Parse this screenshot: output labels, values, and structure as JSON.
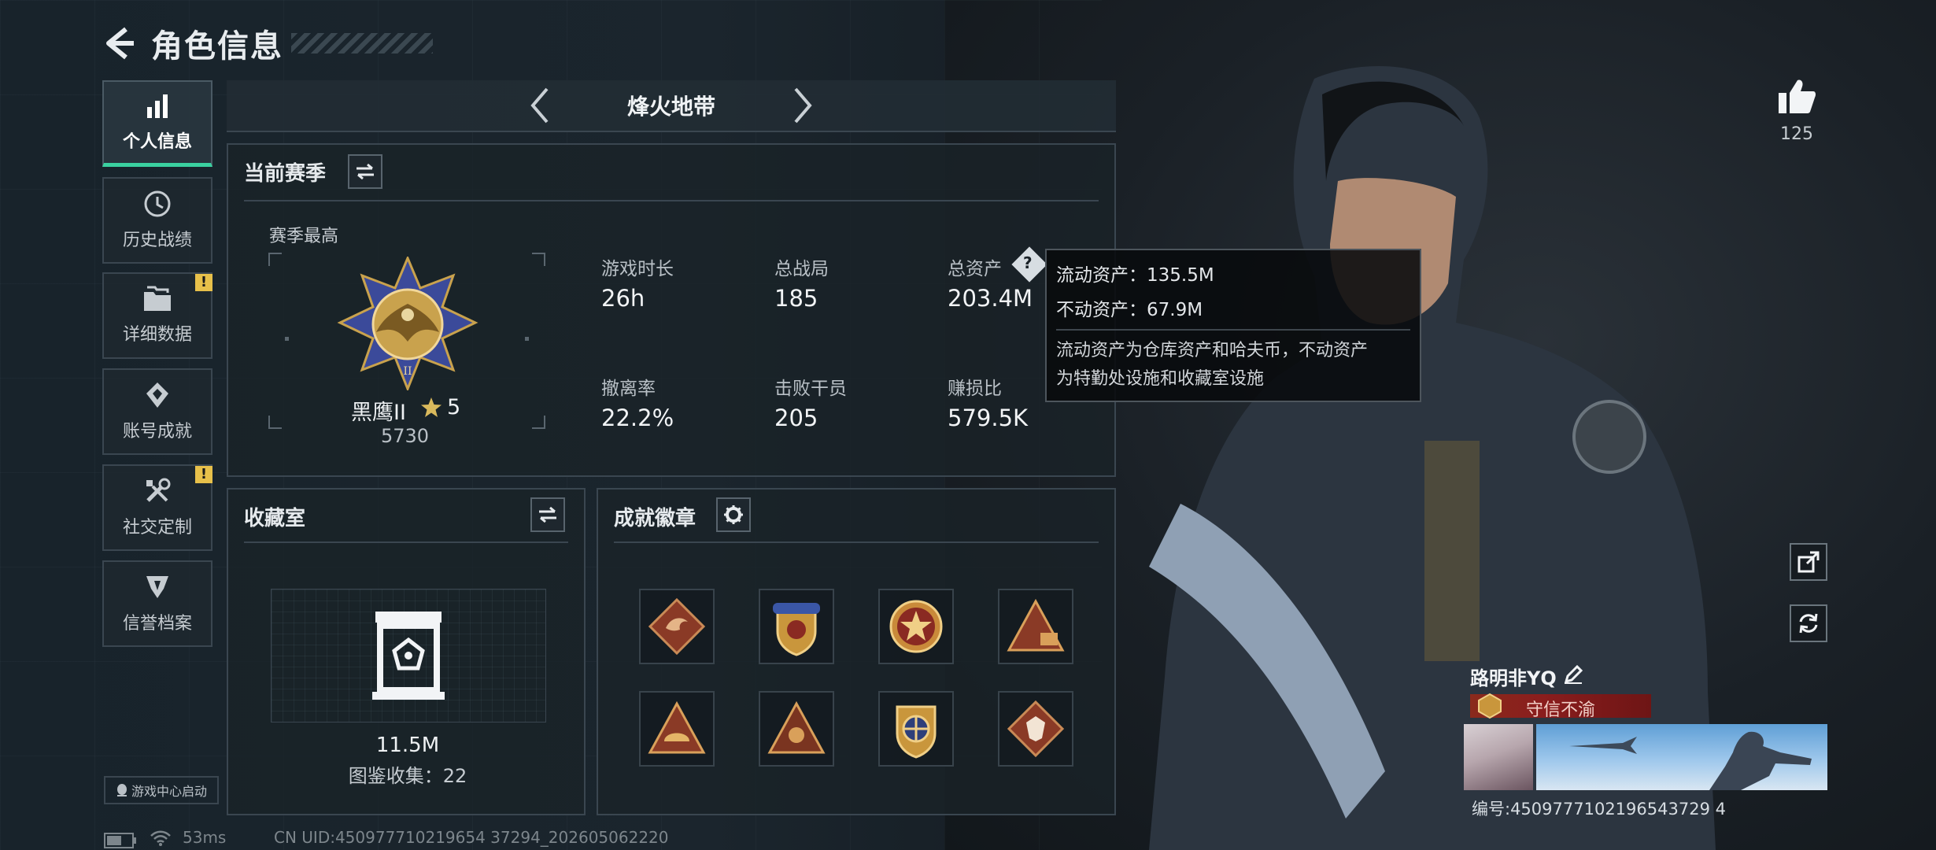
{
  "header": {
    "title": "角色信息"
  },
  "nav": [
    {
      "label": "个人信息",
      "icon": "bar-chart-icon",
      "active": true,
      "warning": false
    },
    {
      "label": "历史战绩",
      "icon": "history-icon",
      "active": false,
      "warning": false
    },
    {
      "label": "详细数据",
      "icon": "folder-icon",
      "active": false,
      "warning": true
    },
    {
      "label": "账号成就",
      "icon": "achievement-icon",
      "active": false,
      "warning": false
    },
    {
      "label": "社交定制",
      "icon": "tools-icon",
      "active": false,
      "warning": true
    },
    {
      "label": "信誉档案",
      "icon": "credit-icon",
      "active": false,
      "warning": false
    }
  ],
  "warning_mark": "!",
  "mode": {
    "title": "烽火地带"
  },
  "season": {
    "title": "当前赛季",
    "best_label": "赛季最高",
    "rank_name": "黑鹰II",
    "rank_stars": "5",
    "rank_score": "5730",
    "stats": [
      {
        "label": "游戏时长",
        "value": "26h"
      },
      {
        "label": "总战局",
        "value": "185"
      },
      {
        "label": "总资产",
        "value": "203.4M"
      },
      {
        "label": "撤离率",
        "value": "22.2%"
      },
      {
        "label": "击败干员",
        "value": "205"
      },
      {
        "label": "赚损比",
        "value": "579.5K"
      }
    ]
  },
  "tooltip": {
    "liquid": "流动资产：135.5M",
    "fixed": "不动资产：67.9M",
    "desc_line1": "流动资产为仓库资产和哈夫币，不动资产",
    "desc_line2": "为特勤处设施和收藏室设施"
  },
  "collection": {
    "title": "收藏室",
    "value": "11.5M",
    "count": "图鉴收集：22"
  },
  "badges": {
    "title": "成就徽章",
    "count": 8
  },
  "likes": {
    "count": "125"
  },
  "player": {
    "name": "路明非YQ",
    "title": "守信不渝",
    "uid": "编号:4509777102196543729 4"
  },
  "footer": {
    "game_center": "游戏中心启动",
    "ping": "53ms",
    "uid_line": "CN UID:450977710219654 37294_202605062220"
  },
  "colors": {
    "accent": "#3ad1a0",
    "warning": "#e7c04a",
    "title_red": "#8a1d1d"
  }
}
